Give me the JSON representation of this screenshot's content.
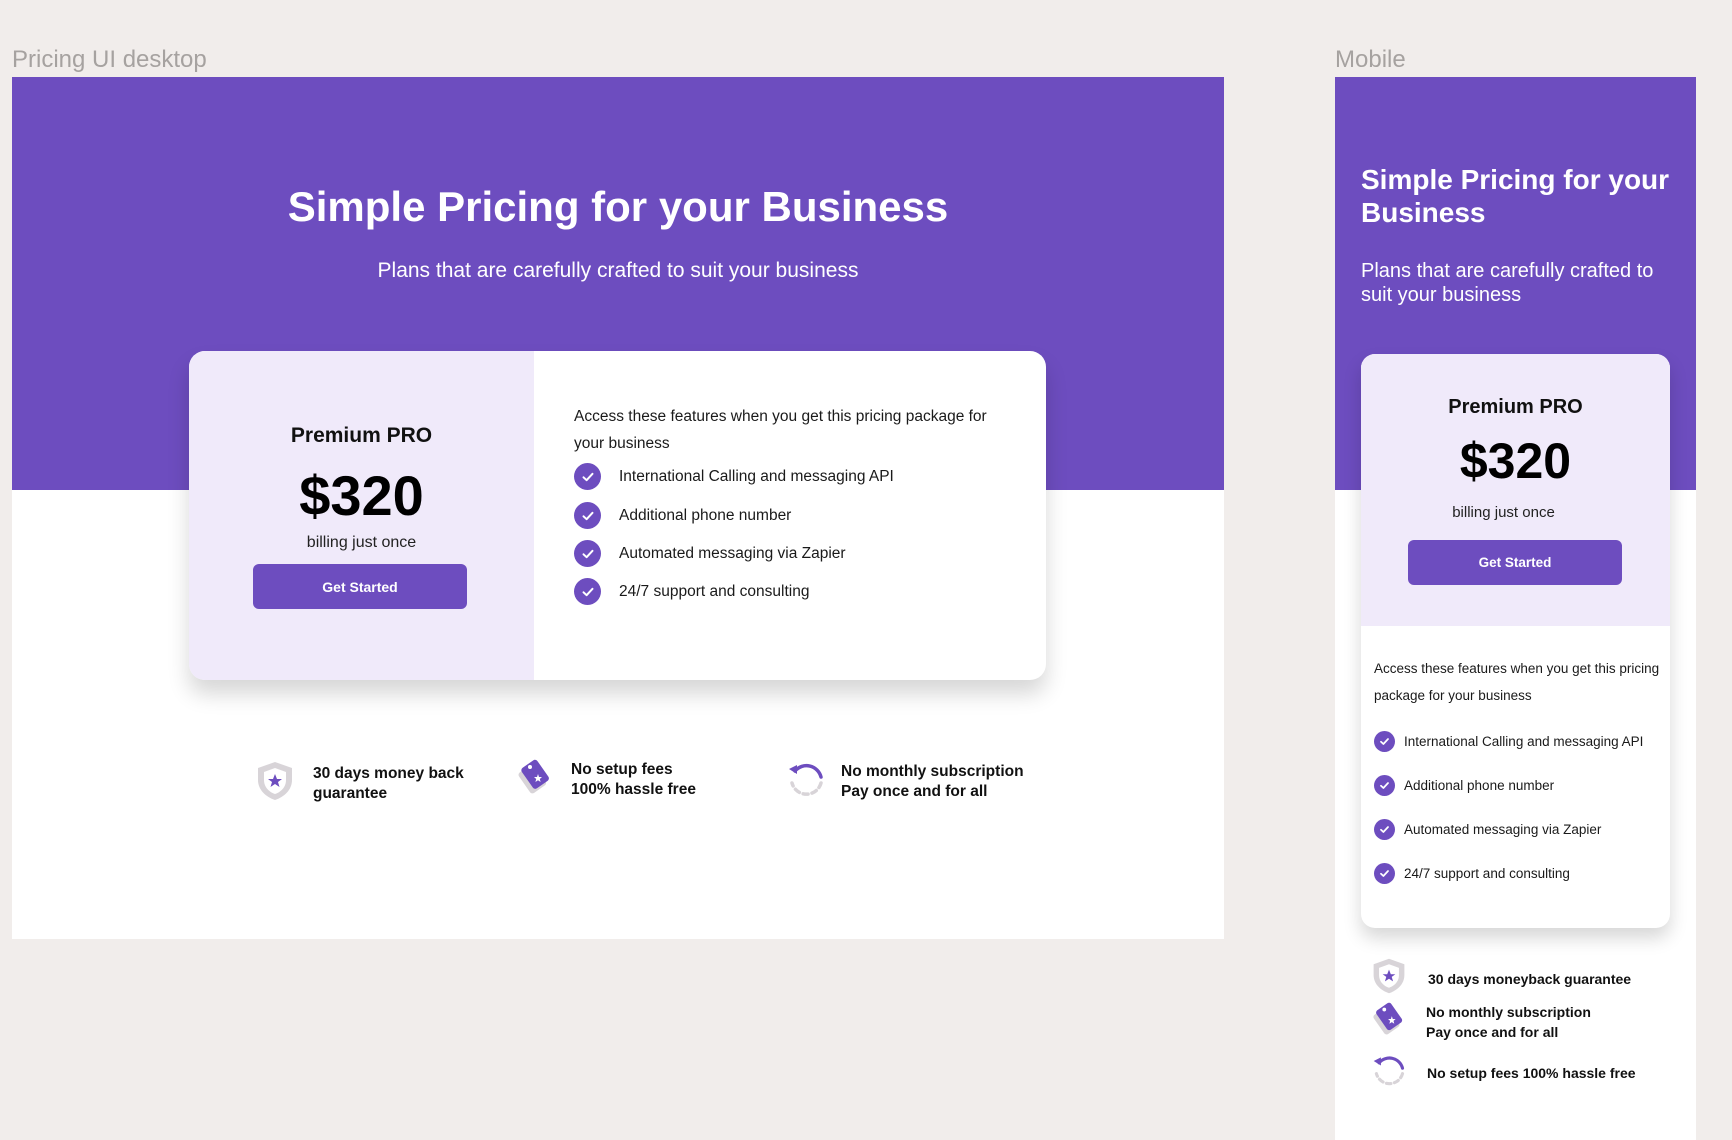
{
  "frames": {
    "desktop_label": "Pricing UI desktop",
    "mobile_label": "Mobile"
  },
  "colors": {
    "brand": "#6d4dbf",
    "plan_panel": "#f0eafa",
    "canvas": "#f1edeb"
  },
  "hero": {
    "title": "Simple Pricing for your Business",
    "subtitle": "Plans that are carefully crafted to suit your business"
  },
  "plan": {
    "name": "Premium PRO",
    "price": "$320",
    "billing": "billing just once",
    "cta_label": "Get Started"
  },
  "features": {
    "intro": "Access these features when you get this pricing package for your business",
    "items": [
      "International Calling and messaging API",
      "Additional phone number",
      "Automated messaging via Zapier",
      "24/7 support and consulting"
    ]
  },
  "guarantees_desktop": [
    {
      "icon": "shield-star-icon",
      "line1": "30 days money back",
      "line2": "guarantee"
    },
    {
      "icon": "price-tag-icon",
      "line1": "No setup fees",
      "line2": "100% hassle free"
    },
    {
      "icon": "refresh-cycle-icon",
      "line1": "No monthly subscription",
      "line2": "Pay once and for all"
    }
  ],
  "guarantees_mobile": [
    {
      "icon": "shield-star-icon",
      "line1": "30 days moneyback guarantee",
      "line2": ""
    },
    {
      "icon": "price-tag-icon",
      "line1": "No monthly subscription",
      "line2": "Pay once and for all"
    },
    {
      "icon": "refresh-cycle-icon",
      "line1": "No setup fees 100% hassle free",
      "line2": ""
    }
  ]
}
